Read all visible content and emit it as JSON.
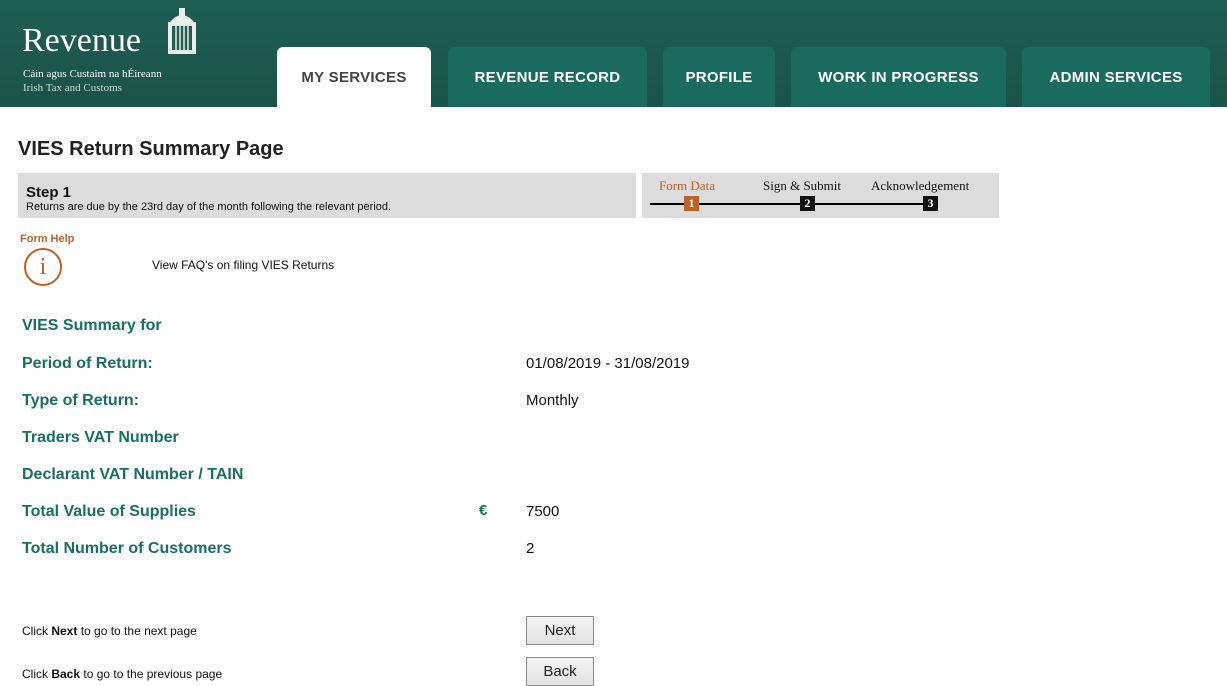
{
  "header": {
    "logo_word": "Revenue",
    "logo_sub1": "Cáin agus Custaim na hÉireann",
    "logo_sub2": "Irish Tax and Customs",
    "tabs": [
      {
        "label": "MY SERVICES",
        "active": true
      },
      {
        "label": "REVENUE RECORD",
        "active": false
      },
      {
        "label": "PROFILE",
        "active": false
      },
      {
        "label": "WORK IN PROGRESS",
        "active": false
      },
      {
        "label": "ADMIN SERVICES",
        "active": false
      }
    ]
  },
  "page": {
    "title": "VIES Return Summary Page",
    "step_title": "Step 1",
    "step_desc": "Returns are due by the 23rd day of the month following the relevant period."
  },
  "progress": {
    "steps": [
      {
        "label": "Form Data",
        "number": "1",
        "current": true
      },
      {
        "label": "Sign & Submit",
        "number": "2",
        "current": false
      },
      {
        "label": "Acknowledgement",
        "number": "3",
        "current": false
      }
    ]
  },
  "help": {
    "label": "Form Help",
    "icon_glyph": "i",
    "faq_link": "View FAQ's on filing VIES Returns"
  },
  "summary": {
    "heading": "VIES Summary for",
    "period_label": "Period of Return:",
    "period_value": "01/08/2019 - 31/08/2019",
    "type_label": "Type of Return:",
    "type_value": "Monthly",
    "traders_vat_label": "Traders VAT Number",
    "declarant_label": "Declarant VAT Number / TAIN",
    "total_value_label": "Total Value of Supplies",
    "currency_symbol": "€",
    "total_value": "7500",
    "customers_label": "Total Number of Customers",
    "customers_value": "2"
  },
  "actions": {
    "next_prefix": "Click ",
    "next_bold": "Next",
    "next_suffix": " to go to the next page",
    "next_button": "Next",
    "back_prefix": "Click ",
    "back_bold": "Back",
    "back_suffix": " to go to the previous page",
    "back_button": "Back"
  },
  "colors": {
    "header_bg": "#1a5348",
    "tab_bg": "#196b5e",
    "label_green": "#1b6e63",
    "accent_orange": "#c0602a"
  }
}
